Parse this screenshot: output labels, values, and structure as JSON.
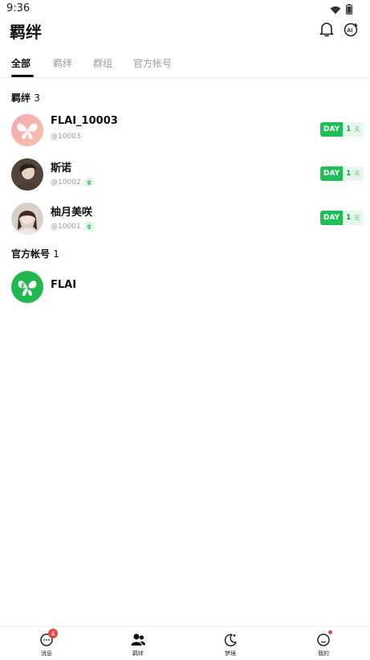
{
  "status_bar": {
    "time": "9:36"
  },
  "header": {
    "title": "羁绊"
  },
  "tabs": [
    {
      "label": "全部",
      "active": true
    },
    {
      "label": "羁绊",
      "active": false
    },
    {
      "label": "群组",
      "active": false
    },
    {
      "label": "官方帐号",
      "active": false
    }
  ],
  "sections": {
    "bonds": {
      "title": "羁绊",
      "count": "3"
    },
    "official": {
      "title": "官方帐号",
      "count": "1"
    }
  },
  "contacts": [
    {
      "name": "FLAI_10003",
      "handle": "@10003",
      "day_label": "DAY",
      "day_value": "1",
      "day_unit": "天"
    },
    {
      "name": "斯诺",
      "handle": "@10002",
      "day_label": "DAY",
      "day_value": "1",
      "day_unit": "天"
    },
    {
      "name": "柚月美咲",
      "handle": "@10001",
      "day_label": "DAY",
      "day_value": "1",
      "day_unit": "天"
    }
  ],
  "official_accounts": [
    {
      "name": "FLAI"
    }
  ],
  "bottom_nav": [
    {
      "label": "消息",
      "icon": "message-icon",
      "badge": "4"
    },
    {
      "label": "羁绊",
      "icon": "people-icon"
    },
    {
      "label": "梦境",
      "icon": "moon-icon"
    },
    {
      "label": "我的",
      "icon": "profile-icon"
    }
  ],
  "colors": {
    "accent_green": "#1fbf57",
    "badge_red": "#e84545"
  }
}
